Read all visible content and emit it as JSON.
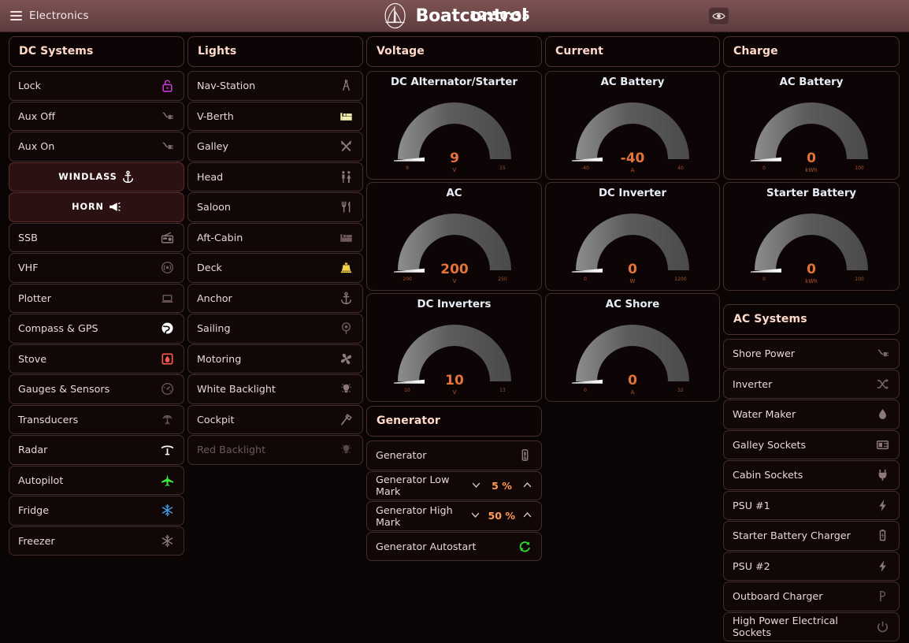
{
  "header": {
    "menu_label": "Electronics",
    "brand": "Boatcontrol",
    "clock": "12:50:35",
    "menu_icon": "hamburger-icon",
    "logo_icon": "sailboat-logo-icon",
    "eye_icon": "eye-icon",
    "bg_color": "#6b4646",
    "accent_color": "#ff9a57"
  },
  "columns": {
    "dc_systems": {
      "title": "DC Systems",
      "items": [
        {
          "label": "Lock",
          "icon": "padlock-icon",
          "style": "normal",
          "icon_color": "#c13ad6"
        },
        {
          "label": "Aux Off",
          "icon": "plug-off-icon",
          "style": "normal",
          "icon_color": "#7d6a68"
        },
        {
          "label": "Aux On",
          "icon": "plug-on-icon",
          "style": "normal",
          "icon_color": "#7d6a68"
        },
        {
          "label": "WINDLASS",
          "icon": "anchor-icon",
          "style": "accent",
          "icon_color": "#ffffff"
        },
        {
          "label": "HORN",
          "icon": "horn-icon",
          "style": "accent",
          "icon_color": "#ffffff"
        },
        {
          "label": "SSB",
          "icon": "radio-icon",
          "style": "normal",
          "icon_color": "#8d7a78"
        },
        {
          "label": "VHF",
          "icon": "antenna-signal-icon",
          "style": "normal",
          "icon_color": "#6f5c5a"
        },
        {
          "label": "Plotter",
          "icon": "laptop-icon",
          "style": "normal",
          "icon_color": "#6f5c5a"
        },
        {
          "label": "Compass & GPS",
          "icon": "globe-icon",
          "style": "normal",
          "icon_color": "#ffffff"
        },
        {
          "label": "Stove",
          "icon": "stove-flame-icon",
          "style": "normal",
          "icon_color": "#ff5c4d"
        },
        {
          "label": "Gauges & Sensors",
          "icon": "gauge-icon",
          "style": "normal",
          "icon_color": "#6a5755"
        },
        {
          "label": "Transducers",
          "icon": "sonar-icon",
          "style": "normal",
          "icon_color": "#6a5755"
        },
        {
          "label": "Radar",
          "icon": "radar-icon",
          "style": "normal",
          "icon_color": "#ffffff"
        },
        {
          "label": "Autopilot",
          "icon": "airplane-icon",
          "style": "normal",
          "icon_color": "#3ae83a"
        },
        {
          "label": "Fridge",
          "icon": "snowflake-icon",
          "style": "normal",
          "icon_color": "#3fa0e8"
        },
        {
          "label": "Freezer",
          "icon": "snowflake-icon",
          "style": "normal",
          "icon_color": "#8d7a78"
        }
      ]
    },
    "lights": {
      "title": "Lights",
      "items": [
        {
          "label": "Nav-Station",
          "icon": "dividers-icon",
          "style": "normal",
          "icon_color": "#8d7a78"
        },
        {
          "label": "V-Berth",
          "icon": "bed-icon",
          "style": "normal",
          "icon_color": "#f2edb0"
        },
        {
          "label": "Galley",
          "icon": "crossed-utensils-icon",
          "style": "normal",
          "icon_color": "#8d7a78"
        },
        {
          "label": "Head",
          "icon": "restroom-icon",
          "style": "normal",
          "icon_color": "#8d7a78"
        },
        {
          "label": "Saloon",
          "icon": "fork-knife-icon",
          "style": "normal",
          "icon_color": "#8d7a78"
        },
        {
          "label": "Aft-Cabin",
          "icon": "bed-icon",
          "style": "normal",
          "icon_color": "#6e5b59"
        },
        {
          "label": "Deck",
          "icon": "deck-light-icon",
          "style": "normal",
          "icon_color": "#f2d24a"
        },
        {
          "label": "Anchor",
          "icon": "anchor-icon",
          "style": "normal",
          "icon_color": "#8d7a78"
        },
        {
          "label": "Sailing",
          "icon": "masthead-light-icon",
          "style": "normal",
          "icon_color": "#6e5b59"
        },
        {
          "label": "Motoring",
          "icon": "propeller-icon",
          "style": "normal",
          "icon_color": "#8d7a78"
        },
        {
          "label": "White Backlight",
          "icon": "bulb-icon",
          "style": "normal",
          "icon_color": "#8d7a78"
        },
        {
          "label": "Cockpit",
          "icon": "spotlight-icon",
          "style": "normal",
          "icon_color": "#8d7a78"
        },
        {
          "label": "Red Backlight",
          "icon": "bulb-icon",
          "style": "dim",
          "icon_color": "#5a4644"
        }
      ]
    },
    "voltage": {
      "title": "Voltage",
      "gauges": [
        {
          "title": "DC Alternator/Starter",
          "value": "9",
          "unit": "V",
          "min": "9",
          "max": "15"
        },
        {
          "title": "AC",
          "value": "200",
          "unit": "V",
          "min": "200",
          "max": "250"
        },
        {
          "title": "DC Inverters",
          "value": "10",
          "unit": "V",
          "min": "10",
          "max": "13"
        }
      ]
    },
    "generator": {
      "title": "Generator",
      "items": [
        {
          "label": "Generator",
          "type": "toggle",
          "icon": "generator-switch-icon",
          "icon_color": "#8d7a78"
        },
        {
          "label": "Generator Low Mark",
          "type": "stepper",
          "value": "5 %",
          "down_icon": "chevron-down-icon",
          "up_icon": "chevron-up-icon"
        },
        {
          "label": "Generator High Mark",
          "type": "stepper",
          "value": "50 %",
          "down_icon": "chevron-down-icon",
          "up_icon": "chevron-up-icon"
        },
        {
          "label": "Generator Autostart",
          "type": "toggle",
          "icon": "refresh-cycle-icon",
          "icon_color": "#2fdd2f"
        }
      ]
    },
    "current": {
      "title": "Current",
      "gauges": [
        {
          "title": "AC Battery",
          "value": "-40",
          "unit": "A",
          "min": "-40",
          "max": "40"
        },
        {
          "title": "DC Inverter",
          "value": "0",
          "unit": "W",
          "min": "0",
          "max": "1200"
        },
        {
          "title": "AC Shore",
          "value": "0",
          "unit": "A",
          "min": "0",
          "max": "32"
        }
      ]
    },
    "charge": {
      "title": "Charge",
      "gauges": [
        {
          "title": "AC Battery",
          "value": "0",
          "unit": "kWh",
          "min": "0",
          "max": "100"
        },
        {
          "title": "Starter Battery",
          "value": "0",
          "unit": "kWh",
          "min": "0",
          "max": "100"
        }
      ]
    },
    "ac_systems": {
      "title": "AC Systems",
      "items": [
        {
          "label": "Shore Power",
          "icon": "plug-cable-icon",
          "icon_color": "#7d6a68"
        },
        {
          "label": "Inverter",
          "icon": "shuffle-icon",
          "icon_color": "#7d6a68"
        },
        {
          "label": "Water Maker",
          "icon": "water-drop-icon",
          "icon_color": "#8d7a78"
        },
        {
          "label": "Galley Sockets",
          "icon": "socket-panel-icon",
          "icon_color": "#8d7a78"
        },
        {
          "label": "Cabin Sockets",
          "icon": "plug-icon",
          "icon_color": "#8d7a78"
        },
        {
          "label": "PSU #1",
          "icon": "lightning-bolt-icon",
          "icon_color": "#8d7a78"
        },
        {
          "label": "Starter Battery Charger",
          "icon": "battery-icon",
          "icon_color": "#8d7a78"
        },
        {
          "label": "PSU #2",
          "icon": "lightning-bolt-icon",
          "icon_color": "#8d7a78"
        },
        {
          "label": "Outboard Charger",
          "icon": "outboard-icon",
          "icon_color": "#6e5b59"
        },
        {
          "label": "High Power Electrical Sockets",
          "icon": "power-icon",
          "icon_color": "#6e5b59"
        }
      ]
    }
  }
}
